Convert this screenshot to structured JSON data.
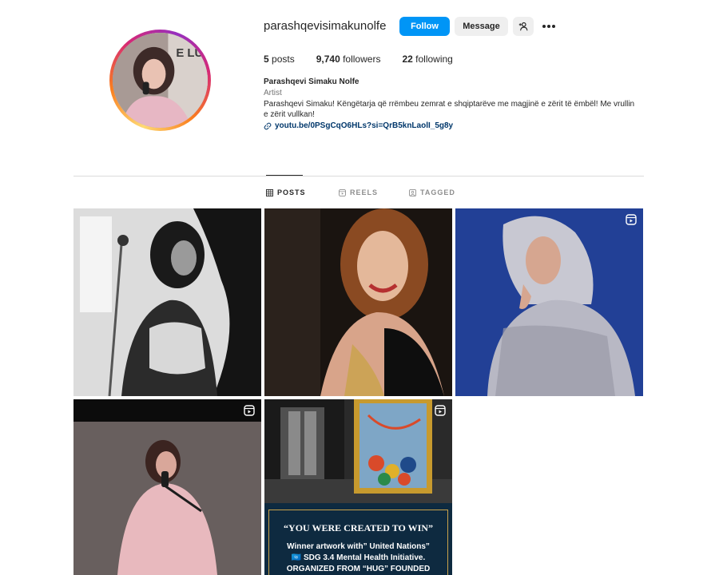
{
  "profile": {
    "username": "parashqevisimakunolfe",
    "follow_label": "Follow",
    "message_label": "Message",
    "avatar_text": "E LUM",
    "posts_count": "5",
    "posts_label": "posts",
    "followers_count": "9,740",
    "followers_label": "followers",
    "following_count": "22",
    "following_label": "following",
    "full_name": "Parashqevi Simaku Nolfe",
    "category": "Artist",
    "bio": "Parashqevi Simaku! Këngëtarja që rrëmbeu zemrat e shqiptarëve me magjinë e zërit të ëmbël! Me vrullin e zërit vullkan!",
    "link": "youtu.be/0PSgCqO6HLs?si=QrB5knLaolI_5g8y"
  },
  "tabs": [
    {
      "label": "POSTS",
      "active": true
    },
    {
      "label": "REELS",
      "active": false
    },
    {
      "label": "TAGGED",
      "active": false
    }
  ],
  "posts": [
    {
      "type": "photo",
      "description": "black and white singer"
    },
    {
      "type": "photo",
      "description": "smiling woman"
    },
    {
      "type": "reel",
      "description": "woman with scarf"
    },
    {
      "type": "reel",
      "description": "singer in pink"
    },
    {
      "type": "reel",
      "description": "poster",
      "poster_title": "“YOU WERE CREATED TO WIN”",
      "poster_line1": "Winner artwork with” United Nations”",
      "poster_line2": "🇺🇳 SDG 3.4 Mental Health Initiative.",
      "poster_line3": "ORGANIZED FROM “HUG” FOUNDED"
    }
  ],
  "colors": {
    "accent": "#0095f6",
    "link": "#00376b",
    "muted": "#737373"
  },
  "icons": [
    "add-user-icon",
    "more-icon",
    "link-icon",
    "grid-icon",
    "reels-icon",
    "tagged-icon",
    "reel-badge-icon"
  ]
}
